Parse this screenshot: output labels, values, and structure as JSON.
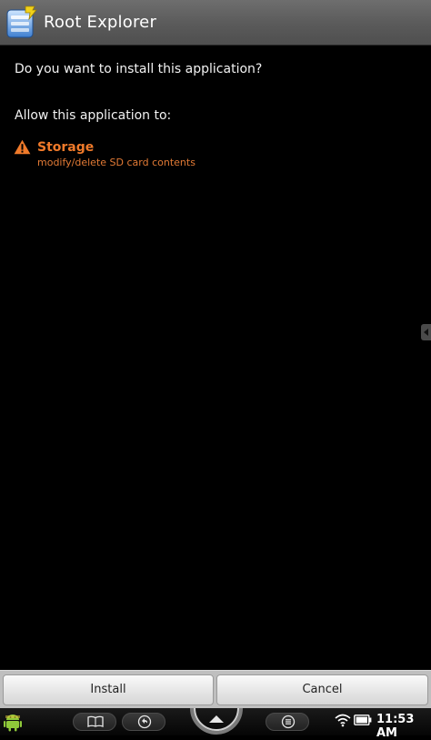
{
  "window": {
    "title": "Root Explorer",
    "icon": "root-explorer-app-icon"
  },
  "dialog": {
    "question": "Do you want to install this application?",
    "allow_label": "Allow this application to:",
    "permissions": [
      {
        "icon": "warning-icon",
        "title": "Storage",
        "description": "modify/delete SD card contents",
        "color": "#f07a2a"
      }
    ]
  },
  "buttons": {
    "install_label": "Install",
    "cancel_label": "Cancel"
  },
  "system_bar": {
    "time": "11:53 AM",
    "icons": [
      "android-icon",
      "book-icon",
      "back-icon",
      "home-icon",
      "menu-icon",
      "wifi-icon",
      "battery-icon"
    ]
  },
  "colors": {
    "accent_warning": "#f07a2a",
    "background": "#000000",
    "titlebar": "#5a5a5a"
  }
}
